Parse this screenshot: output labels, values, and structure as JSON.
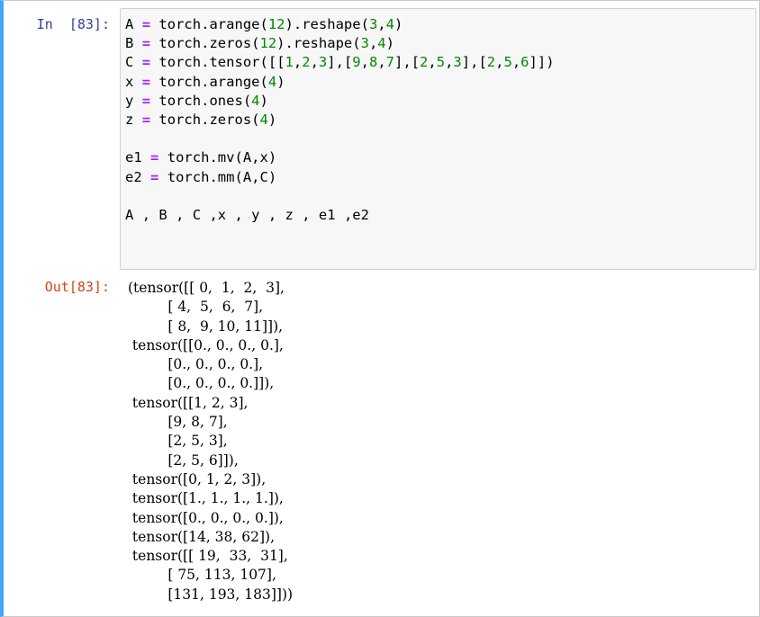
{
  "cell": {
    "in_prompt": "In  [83]:",
    "out_prompt": "Out[83]:",
    "code_lines": [
      "A = torch.arange(12).reshape(3,4)",
      "B = torch.zeros(12).reshape(3,4)",
      "C = torch.tensor([[1,2,3],[9,8,7],[2,5,3],[2,5,6]])",
      "x = torch.arange(4)",
      "y = torch.ones(4)",
      "z = torch.zeros(4)",
      "",
      "e1 = torch.mv(A,x)",
      "e2 = torch.mm(A,C)",
      "",
      "A , B , C ,x , y , z , e1 ,e2"
    ],
    "output_lines": [
      "(tensor([[ 0,  1,  2,  3],",
      "         [ 4,  5,  6,  7],",
      "         [ 8,  9, 10, 11]]),",
      " tensor([[0., 0., 0., 0.],",
      "         [0., 0., 0., 0.],",
      "         [0., 0., 0., 0.]]),",
      " tensor([[1, 2, 3],",
      "         [9, 8, 7],",
      "         [2, 5, 3],",
      "         [2, 5, 6]]),",
      " tensor([0, 1, 2, 3]),",
      " tensor([1., 1., 1., 1.]),",
      " tensor([0., 0., 0., 0.]),",
      " tensor([14, 38, 62]),",
      " tensor([[ 19,  33,  31],",
      "         [ 75, 113, 107],",
      "         [131, 193, 183]]))"
    ]
  },
  "colors": {
    "cell_selected_border": "#42a5f5",
    "in_prompt": "#303f9f",
    "out_prompt": "#d84315",
    "input_background": "#f7f7f7",
    "operator": "#aa22ff",
    "number": "#008800"
  }
}
